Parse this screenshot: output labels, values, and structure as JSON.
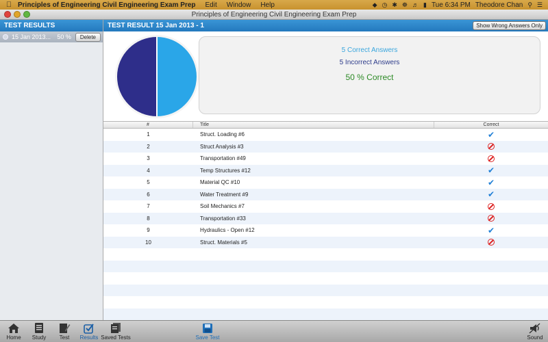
{
  "menubar": {
    "app_name": "Principles of Engineering Civil Engineering Exam Prep",
    "items": [
      "Edit",
      "Window",
      "Help"
    ],
    "clock": "Tue 6:34 PM",
    "user": "Theodore Chan"
  },
  "window": {
    "title": "Principles of Engineering Civil Engineering Exam Prep"
  },
  "sidebar": {
    "header": "TEST RESULTS",
    "rows": [
      {
        "date": "15 Jan 2013...",
        "percent": "50 %",
        "delete_label": "Delete"
      }
    ]
  },
  "main": {
    "header": "TEST RESULT 15 Jan 2013 - 1",
    "wrong_only_label": "Show Wrong Answers Only",
    "summary": {
      "correct": "5 Correct Answers",
      "incorrect": "5 Incorrect Answers",
      "percent": "50 % Correct",
      "correct_fraction": 0.5,
      "colors": {
        "correct": "#2aa6e8",
        "incorrect": "#2e2e8a"
      }
    },
    "table": {
      "columns": [
        "#",
        "Title",
        "Correct"
      ],
      "rows": [
        {
          "num": "1",
          "title": "Struct. Loading #6",
          "correct": true
        },
        {
          "num": "2",
          "title": "Struct Analysis #3",
          "correct": false
        },
        {
          "num": "3",
          "title": "Transportation #49",
          "correct": false
        },
        {
          "num": "4",
          "title": "Temp Structures #12",
          "correct": true
        },
        {
          "num": "5",
          "title": "Material QC #10",
          "correct": true
        },
        {
          "num": "6",
          "title": "Water Treatment #9",
          "correct": true
        },
        {
          "num": "7",
          "title": "Soil Mechanics #7",
          "correct": false
        },
        {
          "num": "8",
          "title": "Transportation #33",
          "correct": false
        },
        {
          "num": "9",
          "title": "Hydraulics - Open #12",
          "correct": true
        },
        {
          "num": "10",
          "title": "Struct. Materials #5",
          "correct": false
        }
      ]
    }
  },
  "toolbar": {
    "home": "Home",
    "study": "Study",
    "test": "Test",
    "results": "Results",
    "saved_tests": "Saved Tests",
    "save_test": "Save Test",
    "sound": "Sound"
  },
  "icons": {
    "apple": "apple-icon",
    "check": "checkmark-icon",
    "wrong": "prohibited-icon",
    "home": "house-icon",
    "study": "notebook-icon",
    "test": "pencil-icon",
    "results": "checkbox-icon",
    "saved": "documents-icon",
    "save": "floppy-disk-icon",
    "sound": "speaker-icon"
  }
}
